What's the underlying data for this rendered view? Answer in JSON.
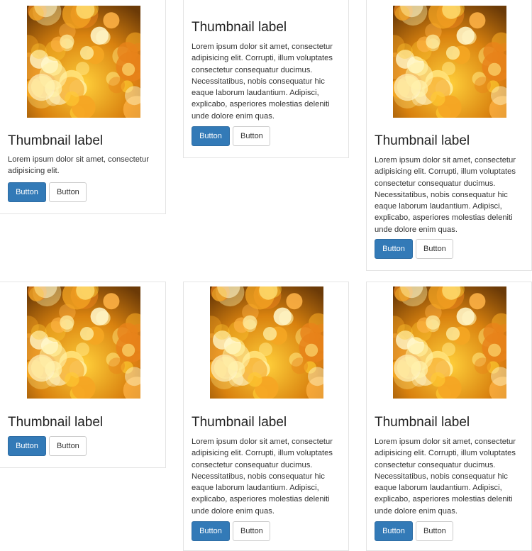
{
  "thumbnails": [
    {
      "label": "Thumbnail label",
      "text": "Lorem ipsum dolor sit amet, consectetur adipisicing elit.",
      "primary_button": "Button",
      "secondary_button": "Button"
    },
    {
      "label": "Thumbnail label",
      "text": "Lorem ipsum dolor sit amet, consectetur adipisicing elit. Corrupti, illum voluptates consectetur consequatur ducimus. Necessitatibus, nobis consequatur hic eaque laborum laudantium. Adipisci, explicabo, asperiores molestias deleniti unde dolore enim quas.",
      "primary_button": "Button",
      "secondary_button": "Button"
    },
    {
      "label": "Thumbnail label",
      "text": "Lorem ipsum dolor sit amet, consectetur adipisicing elit. Corrupti, illum voluptates consectetur consequatur ducimus. Necessitatibus, nobis consequatur hic eaque laborum laudantium. Adipisci, explicabo, asperiores molestias deleniti unde dolore enim quas.",
      "primary_button": "Button",
      "secondary_button": "Button"
    },
    {
      "label": "Thumbnail label",
      "primary_button": "Button",
      "secondary_button": "Button"
    },
    {
      "label": "Thumbnail label",
      "text": "Lorem ipsum dolor sit amet, consectetur adipisicing elit. Corrupti, illum voluptates consectetur consequatur ducimus. Necessitatibus, nobis consequatur hic eaque laborum laudantium. Adipisci, explicabo, asperiores molestias deleniti unde dolore enim quas.",
      "primary_button": "Button",
      "secondary_button": "Button"
    },
    {
      "label": "Thumbnail label",
      "text": "Lorem ipsum dolor sit amet, consectetur adipisicing elit. Corrupti, illum voluptates consectetur consequatur ducimus. Necessitatibus, nobis consequatur hic eaque laborum laudantium. Adipisci, explicabo, asperiores molestias deleniti unde dolore enim quas.",
      "primary_button": "Button",
      "secondary_button": "Button"
    }
  ],
  "colors": {
    "primary_button": "#337ab7",
    "card_border": "#e4e4e4"
  }
}
